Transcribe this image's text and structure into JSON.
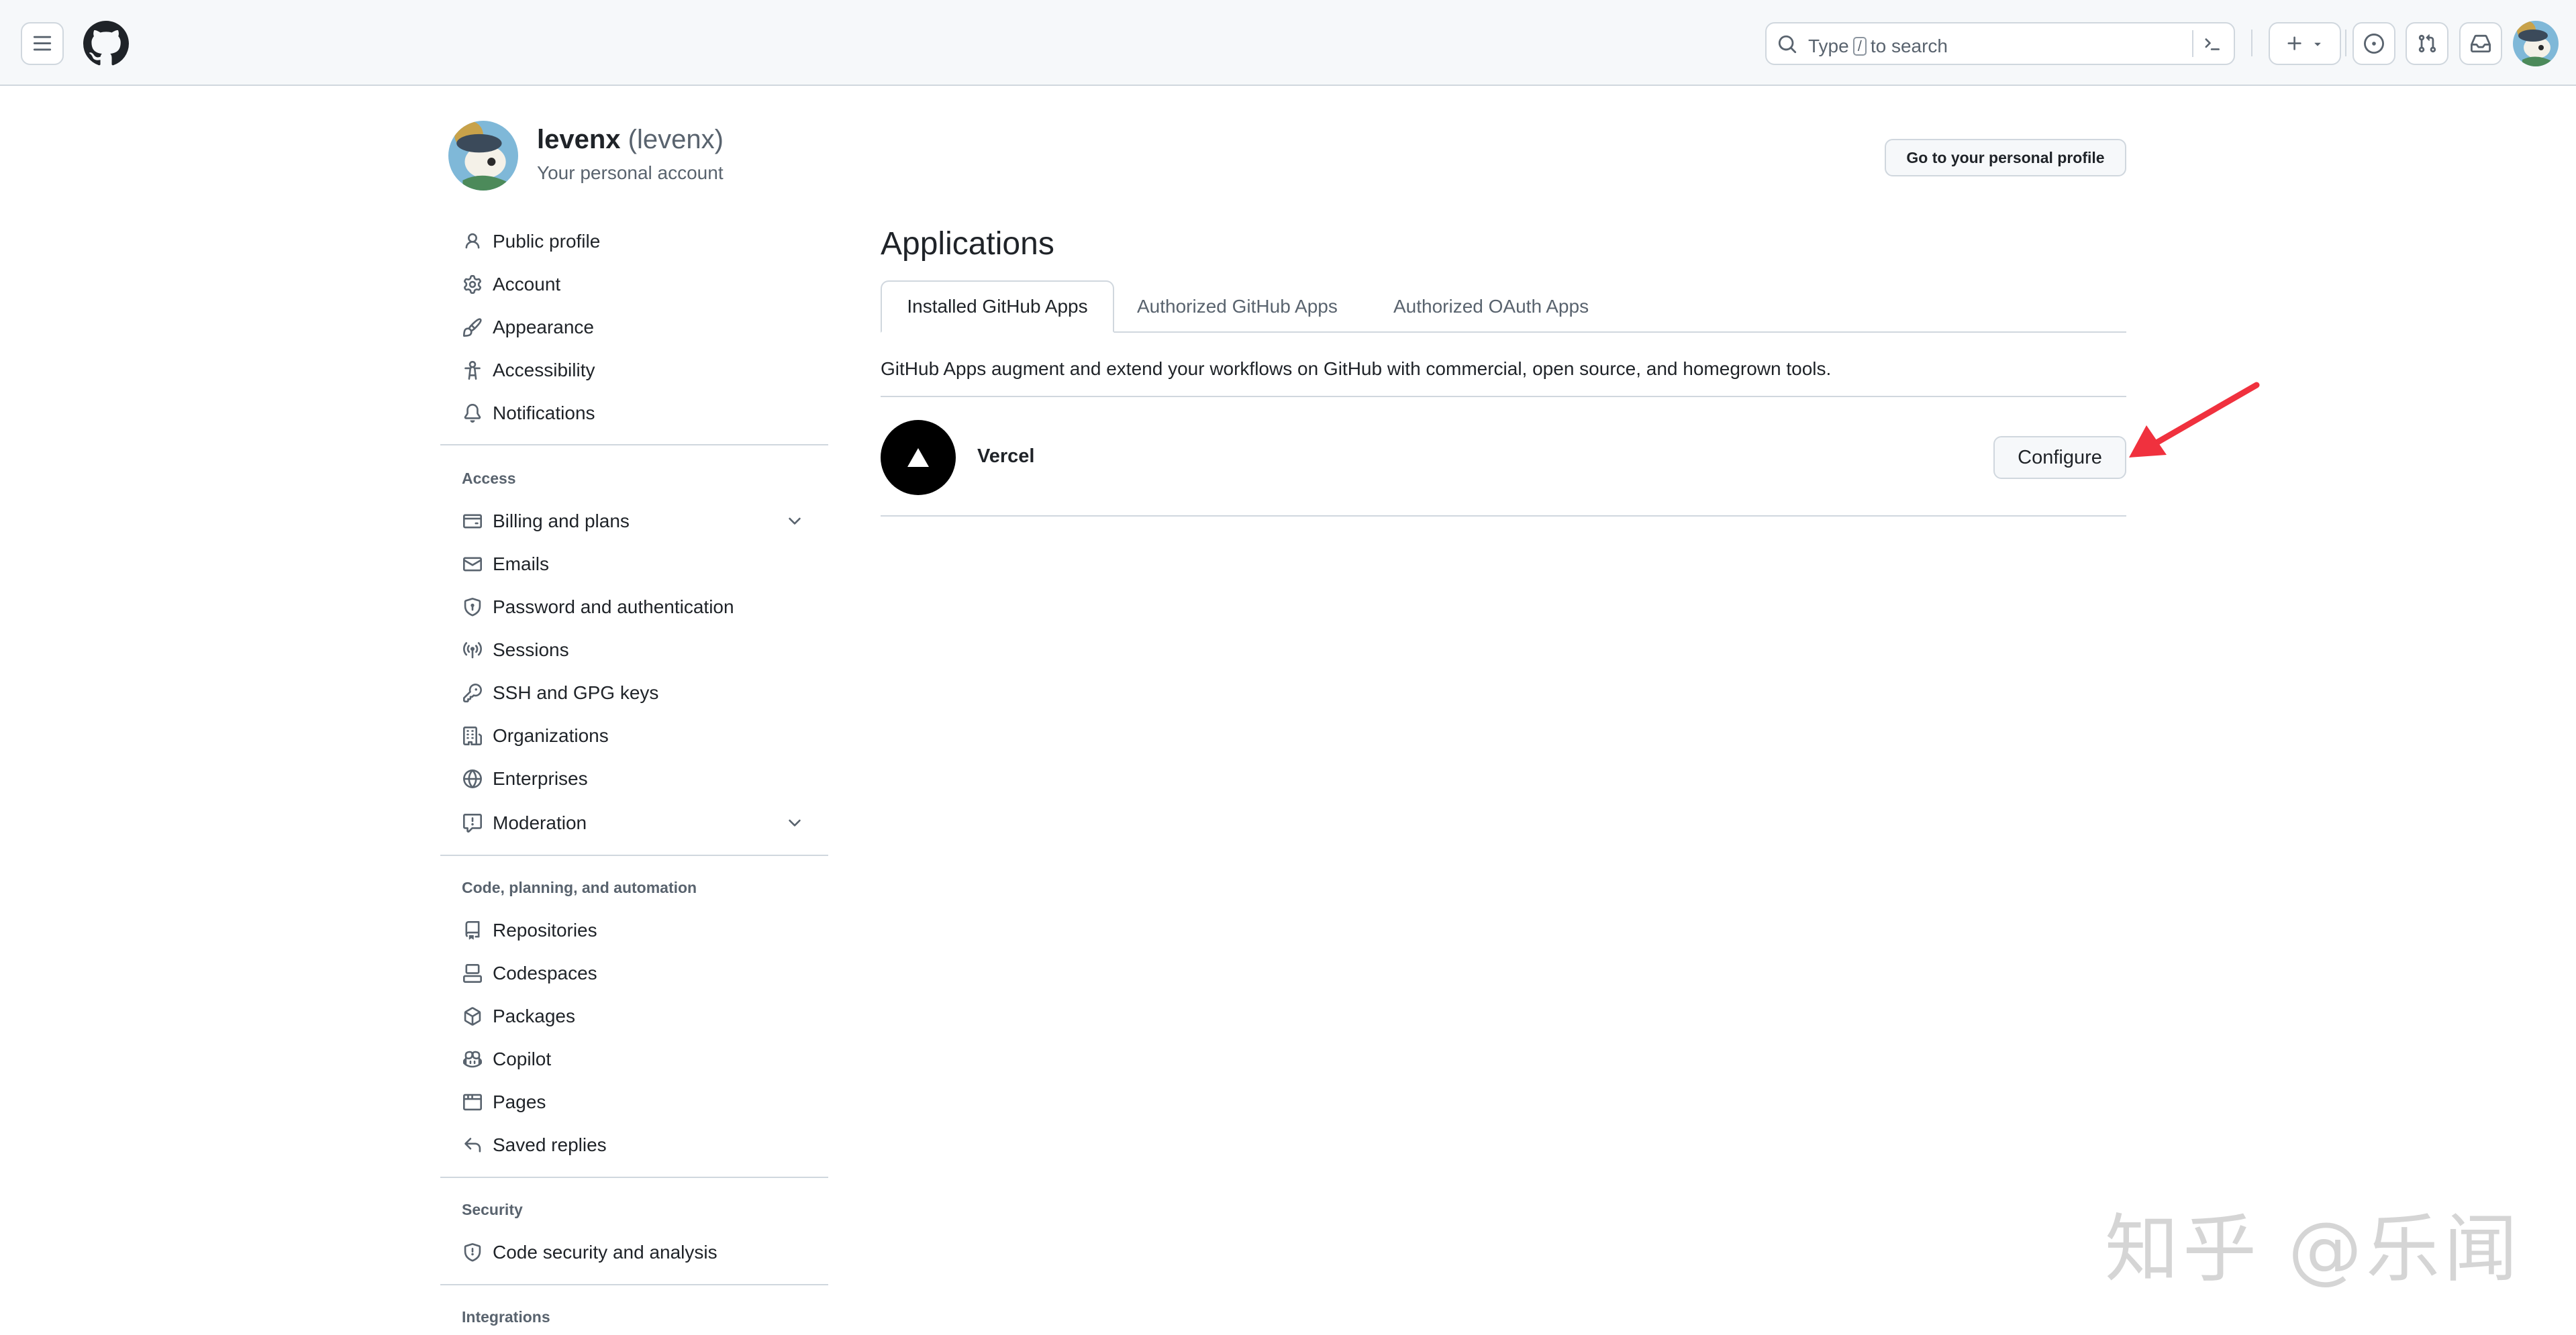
{
  "header": {
    "search_placeholder_before": "Type",
    "search_key": "/",
    "search_placeholder_after": "to search",
    "create_label": "+"
  },
  "profile": {
    "name": "levenx",
    "login": "(levenx)",
    "subtitle": "Your personal account"
  },
  "sidebar": {
    "items": [
      {
        "label": "Public profile",
        "icon": "person-icon"
      },
      {
        "label": "Account",
        "icon": "gear-icon"
      },
      {
        "label": "Appearance",
        "icon": "paintbrush-icon"
      },
      {
        "label": "Accessibility",
        "icon": "accessibility-icon"
      },
      {
        "label": "Notifications",
        "icon": "bell-icon"
      }
    ],
    "access_heading": "Access",
    "access_items": [
      {
        "label": "Billing and plans",
        "icon": "credit-card-icon"
      },
      {
        "label": "Emails",
        "icon": "mail-icon"
      },
      {
        "label": "Password and authentication",
        "icon": "shield-lock-icon"
      },
      {
        "label": "Sessions",
        "icon": "broadcast-icon"
      },
      {
        "label": "SSH and GPG keys",
        "icon": "key-icon"
      },
      {
        "label": "Organizations",
        "icon": "organization-icon"
      },
      {
        "label": "Enterprises",
        "icon": "globe-icon"
      },
      {
        "label": "Moderation",
        "icon": "report-icon"
      }
    ],
    "code_heading": "Code, planning, and automation",
    "code_items": [
      {
        "label": "Repositories",
        "icon": "repo-icon"
      },
      {
        "label": "Codespaces",
        "icon": "codespaces-icon"
      },
      {
        "label": "Packages",
        "icon": "package-icon"
      },
      {
        "label": "Copilot",
        "icon": "copilot-icon"
      },
      {
        "label": "Pages",
        "icon": "browser-icon"
      },
      {
        "label": "Saved replies",
        "icon": "reply-icon"
      }
    ],
    "security_heading": "Security",
    "security_items": [
      {
        "label": "Code security and analysis",
        "icon": "shield-icon"
      }
    ],
    "integrations_heading": "Integrations"
  },
  "main": {
    "goto_profile_label": "Go to your personal profile",
    "title": "Applications",
    "tabs": [
      {
        "label": "Installed GitHub Apps",
        "active": true
      },
      {
        "label": "Authorized GitHub Apps",
        "active": false
      },
      {
        "label": "Authorized OAuth Apps",
        "active": false
      }
    ],
    "description": "GitHub Apps augment and extend your workflows on GitHub with commercial, open source, and homegrown tools.",
    "apps": [
      {
        "name": "Vercel",
        "action_label": "Configure"
      }
    ]
  },
  "annotation": {
    "arrow_color": "#f0313e"
  },
  "watermark": {
    "text": "知乎 @乐闻"
  },
  "colors": {
    "header_bg": "#f6f8fa",
    "border": "#d0d7de",
    "text_primary": "#1f2328",
    "text_muted": "#59636e"
  }
}
